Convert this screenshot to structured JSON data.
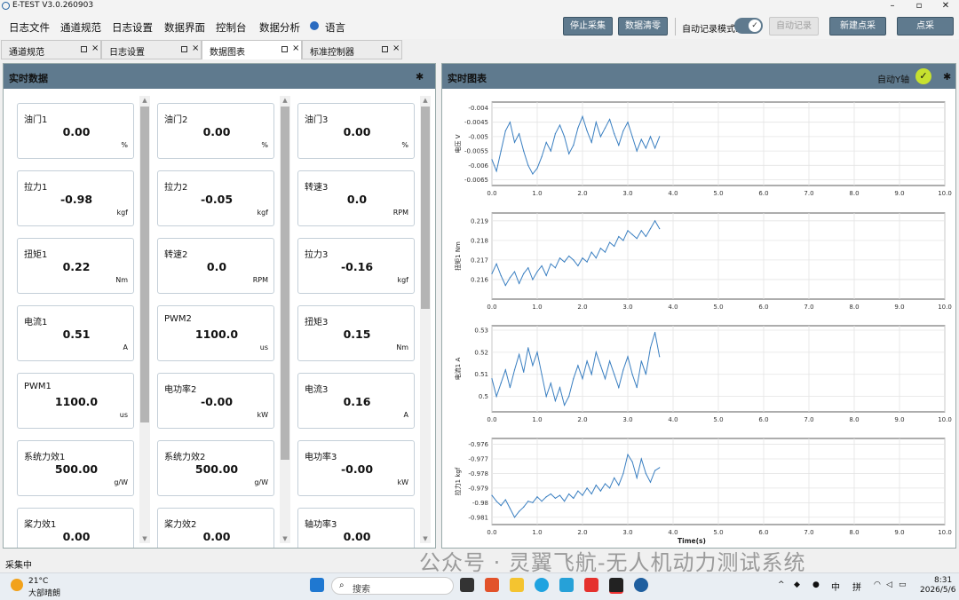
{
  "window": {
    "title": "E-TEST V3.0.260903",
    "minimize_icon": "minimize-icon",
    "maximize_icon": "maximize-icon",
    "close_icon": "close-icon"
  },
  "menu": {
    "items": [
      "日志文件",
      "通道规范",
      "日志设置",
      "数据界面",
      "控制台",
      "数据分析"
    ],
    "language": "语言"
  },
  "toolbar": {
    "stop": "停止采集",
    "clear": "数据清零",
    "auto_mode_label": "自动记录模式:",
    "auto_record": "自动记录",
    "new_point": "新建点采",
    "point": "点采"
  },
  "tabs": [
    {
      "label": "通道规范"
    },
    {
      "label": "日志设置"
    },
    {
      "label": "数据图表"
    },
    {
      "label": "标准控制器"
    }
  ],
  "left_panel": {
    "title": "实时数据",
    "columns": [
      [
        {
          "label": "油门1",
          "value": "0.00",
          "unit": "%"
        },
        {
          "label": "拉力1",
          "value": "-0.98",
          "unit": "kgf"
        },
        {
          "label": "扭矩1",
          "value": "0.22",
          "unit": "Nm"
        },
        {
          "label": "电流1",
          "value": "0.51",
          "unit": "A"
        },
        {
          "label": "PWM1",
          "value": "1100.0",
          "unit": "us"
        },
        {
          "label": "系统力效1",
          "value": "500.00",
          "unit": "g/W"
        },
        {
          "label": "桨力效1",
          "value": "0.00",
          "unit": ""
        }
      ],
      [
        {
          "label": "油门2",
          "value": "0.00",
          "unit": "%"
        },
        {
          "label": "拉力2",
          "value": "-0.05",
          "unit": "kgf"
        },
        {
          "label": "转速2",
          "value": "0.0",
          "unit": "RPM"
        },
        {
          "label": "PWM2",
          "value": "1100.0",
          "unit": "us"
        },
        {
          "label": "电功率2",
          "value": "-0.00",
          "unit": "kW"
        },
        {
          "label": "系统力效2",
          "value": "500.00",
          "unit": "g/W"
        },
        {
          "label": "桨力效2",
          "value": "0.00",
          "unit": ""
        }
      ],
      [
        {
          "label": "油门3",
          "value": "0.00",
          "unit": "%"
        },
        {
          "label": "转速3",
          "value": "0.0",
          "unit": "RPM"
        },
        {
          "label": "拉力3",
          "value": "-0.16",
          "unit": "kgf"
        },
        {
          "label": "扭矩3",
          "value": "0.15",
          "unit": "Nm"
        },
        {
          "label": "电流3",
          "value": "0.16",
          "unit": "A"
        },
        {
          "label": "电功率3",
          "value": "-0.00",
          "unit": "kW"
        },
        {
          "label": "轴功率3",
          "value": "0.00",
          "unit": ""
        }
      ]
    ]
  },
  "right_panel": {
    "title": "实时图表",
    "auto_y_label": "自动Y轴",
    "auto_y_checked": true
  },
  "status_bar": {
    "text": "采集中"
  },
  "taskbar": {
    "weather_temp": "21°C",
    "weather_desc": "大部晴朗",
    "search_placeholder": "搜索",
    "ime_lang": "中",
    "ime_mode": "拼",
    "time": "8:31",
    "date": "2026/5/6"
  },
  "watermark": "公众号 · 灵翼飞航-无人机动力测试系统",
  "colors": {
    "accent": "#5f7a8e",
    "line": "#3a7fc1",
    "check": "#c7e12f"
  },
  "chart_data": [
    {
      "type": "line",
      "ylabel": "电压 V",
      "xlabel": "",
      "xlim": [
        0,
        10
      ],
      "ylim": [
        -0.0067,
        -0.0038
      ],
      "xticks": [
        "0.0",
        "1.0",
        "2.0",
        "3.0",
        "4.0",
        "5.0",
        "6.0",
        "7.0",
        "8.0",
        "9.0",
        "10.0"
      ],
      "yticks": [
        -0.004,
        -0.0045,
        -0.005,
        -0.0055,
        -0.006,
        -0.0065
      ],
      "ytick_labels": [
        "-0.004",
        "-0.0045",
        "-0.005",
        "-0.0055",
        "-0.006",
        "-0.0065"
      ],
      "grid": true,
      "x": [
        0.0,
        0.1,
        0.2,
        0.3,
        0.4,
        0.5,
        0.6,
        0.7,
        0.8,
        0.9,
        1.0,
        1.1,
        1.2,
        1.3,
        1.4,
        1.5,
        1.6,
        1.7,
        1.8,
        1.9,
        2.0,
        2.1,
        2.2,
        2.3,
        2.4,
        2.5,
        2.6,
        2.7,
        2.8,
        2.9,
        3.0,
        3.1,
        3.2,
        3.3,
        3.4,
        3.5,
        3.6,
        3.7
      ],
      "y": [
        -0.0058,
        -0.0062,
        -0.0055,
        -0.0048,
        -0.0045,
        -0.0052,
        -0.0049,
        -0.0055,
        -0.006,
        -0.0063,
        -0.0061,
        -0.0057,
        -0.0052,
        -0.0055,
        -0.0049,
        -0.0046,
        -0.005,
        -0.0056,
        -0.0053,
        -0.0047,
        -0.0043,
        -0.0048,
        -0.0052,
        -0.0045,
        -0.005,
        -0.0047,
        -0.0044,
        -0.0049,
        -0.0053,
        -0.0048,
        -0.0045,
        -0.005,
        -0.0055,
        -0.0051,
        -0.0054,
        -0.005,
        -0.0054,
        -0.005
      ]
    },
    {
      "type": "line",
      "ylabel": "扭矩1 Nm",
      "xlabel": "",
      "xlim": [
        0,
        10
      ],
      "ylim": [
        0.215,
        0.2194
      ],
      "xticks": [
        "0.0",
        "1.0",
        "2.0",
        "3.0",
        "4.0",
        "5.0",
        "6.0",
        "7.0",
        "8.0",
        "9.0",
        "10.0"
      ],
      "yticks": [
        0.219,
        0.218,
        0.217,
        0.216
      ],
      "ytick_labels": [
        "0.219",
        "0.218",
        "0.217",
        "0.216"
      ],
      "grid": true,
      "x": [
        0.0,
        0.1,
        0.2,
        0.3,
        0.4,
        0.5,
        0.6,
        0.7,
        0.8,
        0.9,
        1.0,
        1.1,
        1.2,
        1.3,
        1.4,
        1.5,
        1.6,
        1.7,
        1.8,
        1.9,
        2.0,
        2.1,
        2.2,
        2.3,
        2.4,
        2.5,
        2.6,
        2.7,
        2.8,
        2.9,
        3.0,
        3.1,
        3.2,
        3.3,
        3.4,
        3.5,
        3.6,
        3.7
      ],
      "y": [
        0.2163,
        0.2168,
        0.2162,
        0.2157,
        0.2161,
        0.2164,
        0.2158,
        0.2163,
        0.2166,
        0.216,
        0.2164,
        0.2167,
        0.2162,
        0.2168,
        0.2166,
        0.2171,
        0.2169,
        0.2172,
        0.217,
        0.2167,
        0.2171,
        0.2169,
        0.2174,
        0.2171,
        0.2176,
        0.2174,
        0.2179,
        0.2177,
        0.2182,
        0.218,
        0.2185,
        0.2183,
        0.2181,
        0.2185,
        0.2182,
        0.2186,
        0.219,
        0.2186
      ]
    },
    {
      "type": "line",
      "ylabel": "电流1 A",
      "xlabel": "",
      "xlim": [
        0,
        10
      ],
      "ylim": [
        0.493,
        0.532
      ],
      "xticks": [
        "0.0",
        "1.0",
        "2.0",
        "3.0",
        "4.0",
        "5.0",
        "6.0",
        "7.0",
        "8.0",
        "9.0",
        "10.0"
      ],
      "yticks": [
        0.53,
        0.52,
        0.51,
        0.5
      ],
      "ytick_labels": [
        "0.53",
        "0.52",
        "0.51",
        "0.5"
      ],
      "grid": true,
      "x": [
        0.0,
        0.1,
        0.2,
        0.3,
        0.4,
        0.5,
        0.6,
        0.7,
        0.8,
        0.9,
        1.0,
        1.1,
        1.2,
        1.3,
        1.4,
        1.5,
        1.6,
        1.7,
        1.8,
        1.9,
        2.0,
        2.1,
        2.2,
        2.3,
        2.4,
        2.5,
        2.6,
        2.7,
        2.8,
        2.9,
        3.0,
        3.1,
        3.2,
        3.3,
        3.4,
        3.5,
        3.6,
        3.7
      ],
      "y": [
        0.508,
        0.5,
        0.506,
        0.512,
        0.504,
        0.512,
        0.519,
        0.511,
        0.522,
        0.514,
        0.52,
        0.51,
        0.5,
        0.506,
        0.498,
        0.504,
        0.496,
        0.5,
        0.508,
        0.514,
        0.508,
        0.516,
        0.51,
        0.52,
        0.514,
        0.508,
        0.516,
        0.51,
        0.504,
        0.512,
        0.518,
        0.51,
        0.504,
        0.516,
        0.51,
        0.522,
        0.529,
        0.518
      ]
    },
    {
      "type": "line",
      "ylabel": "拉力1 kgf",
      "xlabel": "Time(s)",
      "xlim": [
        0,
        10
      ],
      "ylim": [
        -0.9815,
        -0.9756
      ],
      "xticks": [
        "0.0",
        "1.0",
        "2.0",
        "3.0",
        "4.0",
        "5.0",
        "6.0",
        "7.0",
        "8.0",
        "9.0",
        "10.0"
      ],
      "yticks": [
        -0.976,
        -0.977,
        -0.978,
        -0.979,
        -0.98,
        -0.981
      ],
      "ytick_labels": [
        "-0.976",
        "-0.977",
        "-0.978",
        "-0.979",
        "-0.98",
        "-0.981"
      ],
      "grid": true,
      "x": [
        0.0,
        0.1,
        0.2,
        0.3,
        0.4,
        0.5,
        0.6,
        0.7,
        0.8,
        0.9,
        1.0,
        1.1,
        1.2,
        1.3,
        1.4,
        1.5,
        1.6,
        1.7,
        1.8,
        1.9,
        2.0,
        2.1,
        2.2,
        2.3,
        2.4,
        2.5,
        2.6,
        2.7,
        2.8,
        2.9,
        3.0,
        3.1,
        3.2,
        3.3,
        3.4,
        3.5,
        3.6,
        3.7
      ],
      "y": [
        -0.9795,
        -0.9799,
        -0.9802,
        -0.9798,
        -0.9804,
        -0.981,
        -0.9806,
        -0.9803,
        -0.9799,
        -0.98,
        -0.9796,
        -0.9799,
        -0.9796,
        -0.9794,
        -0.9797,
        -0.9795,
        -0.9799,
        -0.9794,
        -0.9797,
        -0.9792,
        -0.9795,
        -0.979,
        -0.9794,
        -0.9788,
        -0.9792,
        -0.9787,
        -0.979,
        -0.9783,
        -0.9788,
        -0.978,
        -0.9767,
        -0.9772,
        -0.9783,
        -0.977,
        -0.978,
        -0.9786,
        -0.9778,
        -0.9776
      ]
    }
  ]
}
